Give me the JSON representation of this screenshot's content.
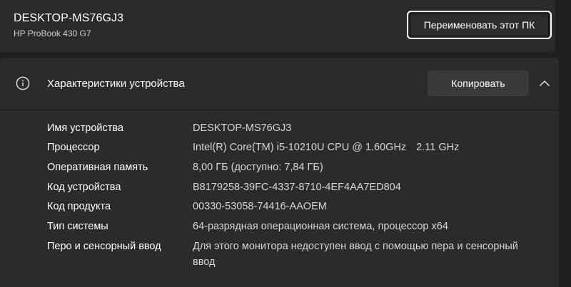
{
  "device": {
    "name": "DESKTOP-MS76GJ3",
    "model": "HP ProBook 430 G7",
    "rename_label": "Переименовать этот ПК"
  },
  "specs": {
    "title": "Характеристики устройства",
    "copy_label": "Копировать",
    "icons": {
      "info": "info-icon",
      "collapse": "chevron-up-icon"
    },
    "rows": [
      {
        "label": "Имя устройства",
        "value": "DESKTOP-MS76GJ3"
      },
      {
        "label": "Процессор",
        "value": "Intel(R) Core(TM) i5-10210U CPU @ 1.60GHz",
        "value_extra": "2.11 GHz"
      },
      {
        "label": "Оперативная память",
        "value": "8,00 ГБ (доступно: 7,84 ГБ)"
      },
      {
        "label": "Код устройства",
        "value": "B8179258-39FC-4337-8710-4EF4AA7ED804"
      },
      {
        "label": "Код продукта",
        "value": "00330-53058-74416-AAOEM"
      },
      {
        "label": "Тип системы",
        "value": "64-разрядная операционная система, процессор x64"
      },
      {
        "label": "Перо и сенсорный ввод",
        "value": "Для этого монитора недоступен ввод с помощью пера и сенсорный ввод"
      }
    ]
  }
}
